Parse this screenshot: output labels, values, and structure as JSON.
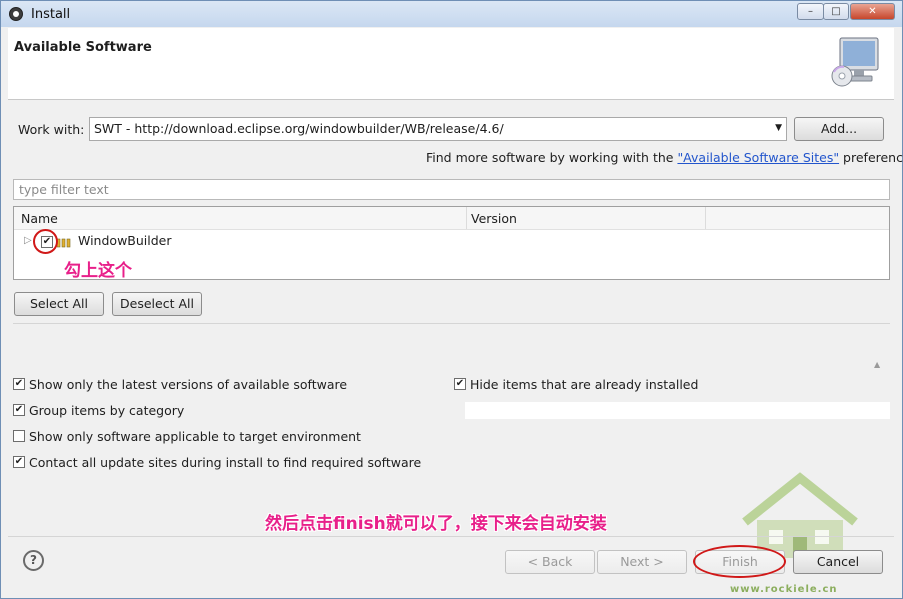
{
  "window": {
    "title": "Install",
    "controls": [
      "–",
      "□",
      "✕"
    ]
  },
  "header": {
    "title": "Available Software"
  },
  "work_with": {
    "label": "Work with:",
    "value": "SWT - http://download.eclipse.org/windowbuilder/WB/release/4.6/",
    "add_button": "Add...",
    "hint_prefix": "Find more software by working with the ",
    "hint_link": "\"Available Software Sites\"",
    "hint_suffix": " preferences."
  },
  "filter": {
    "placeholder": "type filter text"
  },
  "table": {
    "columns": [
      "Name",
      "Version"
    ],
    "rows": [
      {
        "name": "WindowBuilder",
        "checked": true,
        "icon": "software-group-icon"
      }
    ]
  },
  "selection_buttons": {
    "select_all": "Select All",
    "deselect_all": "Deselect All"
  },
  "options": {
    "latest_versions": {
      "label": "Show only the latest versions of available software",
      "checked": true
    },
    "hide_installed": {
      "label": "Hide items that are already installed",
      "checked": true
    },
    "group_by_category": {
      "label": "Group items by category",
      "checked": true
    },
    "target_env": {
      "label": "Show only software applicable to target environment",
      "checked": false
    },
    "contact_sites": {
      "label": "Contact all update sites during install to find required software",
      "checked": true
    }
  },
  "annotations": {
    "check_this": "勾上这个",
    "finish_note": "然后点击finish就可以了，接下来会自动安装"
  },
  "footer": {
    "back": "< Back",
    "next": "Next >",
    "finish": "Finish",
    "cancel": "Cancel"
  },
  "watermark": {
    "site": "www.rockiele.cn"
  },
  "colors": {
    "annotation": "#e8208a",
    "circle": "#d01818",
    "link": "#2255cc"
  }
}
